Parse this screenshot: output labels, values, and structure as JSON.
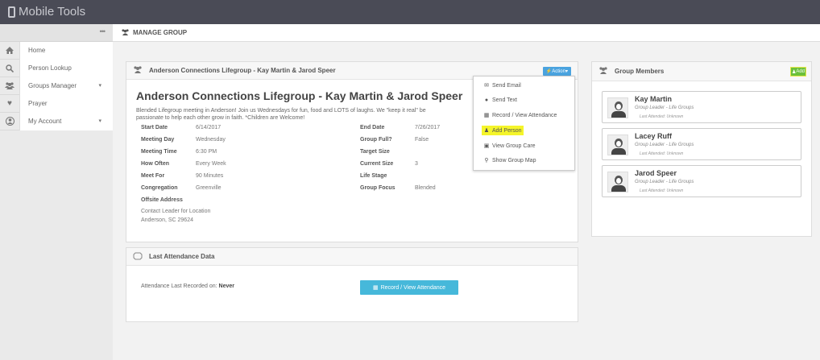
{
  "app": {
    "title": "Mobile Tools"
  },
  "sidebar": {
    "items": [
      {
        "label": "Home",
        "icon": "home-icon"
      },
      {
        "label": "Person Lookup",
        "icon": "search-icon"
      },
      {
        "label": "Groups Manager",
        "icon": "users-icon"
      },
      {
        "label": "Prayer",
        "icon": "heart-icon"
      },
      {
        "label": "My Account",
        "icon": "user-circle-icon"
      }
    ]
  },
  "page": {
    "title": "MANAGE GROUP"
  },
  "group_panel": {
    "header": "Anderson Connections Lifegroup - Kay Martin & Jarod Speer",
    "action_label": "Action",
    "title": "Anderson Connections Lifegroup - Kay Martin & Jarod Speer",
    "description_1": "Blended Lifegroup meeting in Anderson! Join us Wednesdays for fun, food and LOTS of laughs. We \"keep it real\" be",
    "description_2": "passionate to help each other grow in faith. *Children are Welcome!",
    "left_fields": [
      {
        "k": "Start Date",
        "v": "6/14/2017"
      },
      {
        "k": "Meeting Day",
        "v": "Wednesday"
      },
      {
        "k": "Meeting Time",
        "v": "6:30 PM"
      },
      {
        "k": "How Often",
        "v": "Every Week"
      },
      {
        "k": "Meet For",
        "v": "90 Minutes"
      },
      {
        "k": "Congregation",
        "v": "Greenville"
      },
      {
        "k": "Offsite Address",
        "v": ""
      }
    ],
    "right_fields": [
      {
        "k": "End Date",
        "v": "7/26/2017"
      },
      {
        "k": "Group Full?",
        "v": "False"
      },
      {
        "k": "Target Size",
        "v": ""
      },
      {
        "k": "Current Size",
        "v": "3"
      },
      {
        "k": "Life Stage",
        "v": ""
      },
      {
        "k": "Group Focus",
        "v": "Blended"
      }
    ],
    "address_1": "Contact Leader for Location",
    "address_2": "Anderson, SC 29624"
  },
  "action_menu": {
    "items": [
      {
        "label": "Send Email",
        "icon": "envelope-icon"
      },
      {
        "label": "Send Text",
        "icon": "comment-icon"
      },
      {
        "label": "Record / View Attendance",
        "icon": "calendar-icon"
      },
      {
        "label": "Add Person",
        "icon": "user-add-icon",
        "highlighted": true
      },
      {
        "label": "View Group Care",
        "icon": "briefcase-icon"
      },
      {
        "label": "Show Group Map",
        "icon": "map-marker-icon"
      }
    ]
  },
  "attendance_panel": {
    "header": "Last Attendance Data",
    "label": "Attendance Last Recorded on: ",
    "value": "Never",
    "button": "Record / View Attendance"
  },
  "members_panel": {
    "header": "Group Members",
    "add_label": "Add",
    "members": [
      {
        "name": "Kay Martin",
        "role": "Group Leader - Life Groups",
        "last": "Last Attended: Unknown"
      },
      {
        "name": "Lacey Ruff",
        "role": "Group Leader - Life Groups",
        "last": "Last Attended: Unknown"
      },
      {
        "name": "Jarod Speer",
        "role": "Group Leader - Life Groups",
        "last": "Last Attended: Unknown"
      }
    ]
  },
  "colors": {
    "topbar": "#4a4b56",
    "accent": "#4aa3df",
    "add_green": "#6bc03a",
    "highlight": "#f5f52a"
  }
}
